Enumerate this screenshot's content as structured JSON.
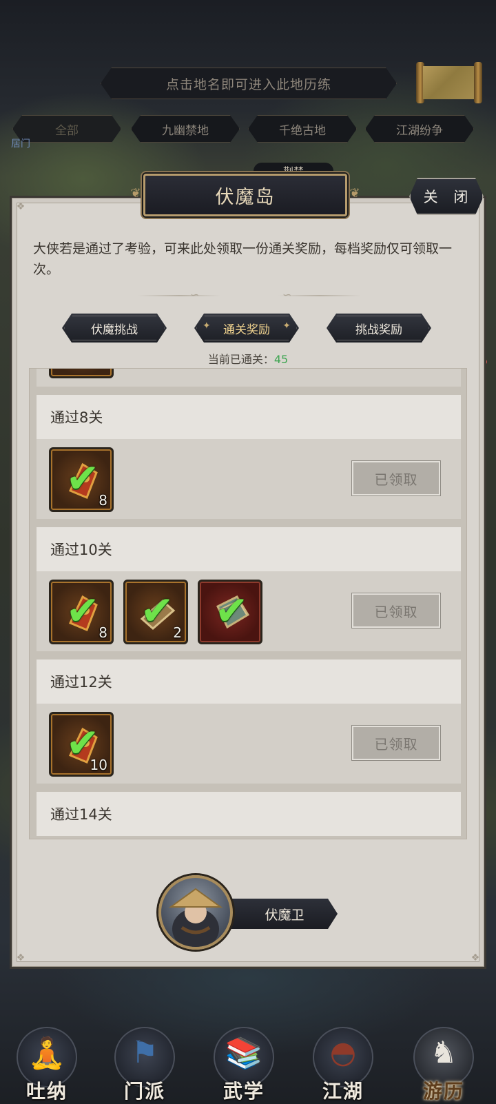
{
  "top": {
    "hint": "点击地名即可进入此地历练",
    "region_tabs": [
      "全部",
      "九幽禁地",
      "千绝古地",
      "江湖纷争"
    ],
    "map_label": "居门",
    "map_pill": "荆楚"
  },
  "panel": {
    "title": "伏魔岛",
    "close_label": "关 闭",
    "description": "大侠若是通过了考验，可来此处领取一份通关奖励，每档奖励仅可领取一次。",
    "tabs": [
      "伏魔挑战",
      "通关奖励",
      "挑战奖励"
    ],
    "active_tab": "通关奖励",
    "cleared_label": "当前已通关：",
    "cleared_value": "45"
  },
  "rewards": [
    {
      "title": "通过8关",
      "items": [
        {
          "icon": "token-check-icon",
          "count": "8",
          "frame": "gold"
        }
      ],
      "status": "已领取"
    },
    {
      "title": "通过10关",
      "items": [
        {
          "icon": "token-check-icon",
          "count": "8",
          "frame": "gold"
        },
        {
          "icon": "book-check-icon",
          "count": "2",
          "frame": "gold"
        },
        {
          "icon": "manual-check-icon",
          "count": "",
          "frame": "red"
        }
      ],
      "status": "已领取"
    },
    {
      "title": "通过12关",
      "items": [
        {
          "icon": "token-check-icon",
          "count": "10",
          "frame": "gold"
        }
      ],
      "status": "已领取"
    },
    {
      "title": "通过14关",
      "items": [],
      "status": ""
    }
  ],
  "npc": {
    "name": "伏魔卫"
  },
  "bottom_nav": [
    {
      "label": "吐纳",
      "icon": "meditation-icon"
    },
    {
      "label": "门派",
      "icon": "sect-banner-icon"
    },
    {
      "label": "武学",
      "icon": "martial-book-icon"
    },
    {
      "label": "江湖",
      "icon": "straw-hat-icon"
    },
    {
      "label": "游历",
      "icon": "horse-icon",
      "active": true
    }
  ],
  "colors": {
    "cleared_value": "#3fa552",
    "check": "#6ee24a",
    "active_tab_text": "#f0d38f"
  }
}
